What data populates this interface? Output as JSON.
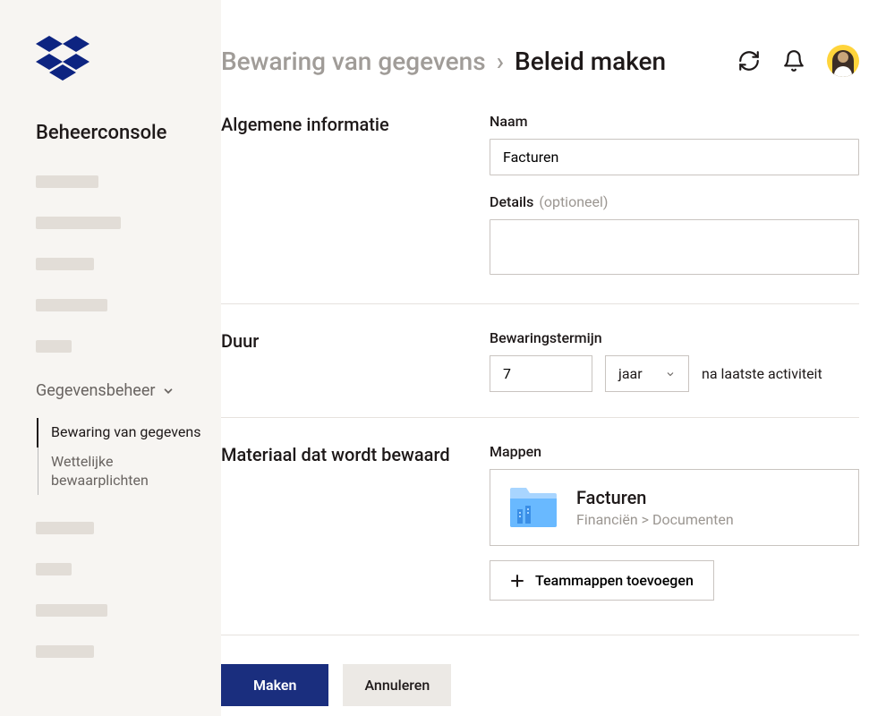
{
  "sidebar": {
    "title": "Beheerconsole",
    "section": "Gegevensbeheer",
    "items": [
      {
        "label": "Bewaring van gegevens",
        "active": true
      },
      {
        "label": "Wettelijke bewaarplichten",
        "active": false
      }
    ]
  },
  "header": {
    "breadcrumb_parent": "Bewaring van gegevens",
    "breadcrumb_current": "Beleid maken"
  },
  "form": {
    "general": {
      "section_title": "Algemene informatie",
      "name_label": "Naam",
      "name_value": "Facturen",
      "details_label": "Details",
      "details_optional": "(optioneel)",
      "details_value": ""
    },
    "duration": {
      "section_title": "Duur",
      "term_label": "Bewaringstermijn",
      "term_value": "7",
      "unit_value": "jaar",
      "hint": "na laatste activiteit"
    },
    "material": {
      "section_title": "Materiaal dat wordt bewaard",
      "folders_label": "Mappen",
      "folder": {
        "name": "Facturen",
        "path": "Financiën > Documenten"
      },
      "add_button": "Teammappen toevoegen"
    }
  },
  "actions": {
    "primary": "Maken",
    "secondary": "Annuleren"
  }
}
